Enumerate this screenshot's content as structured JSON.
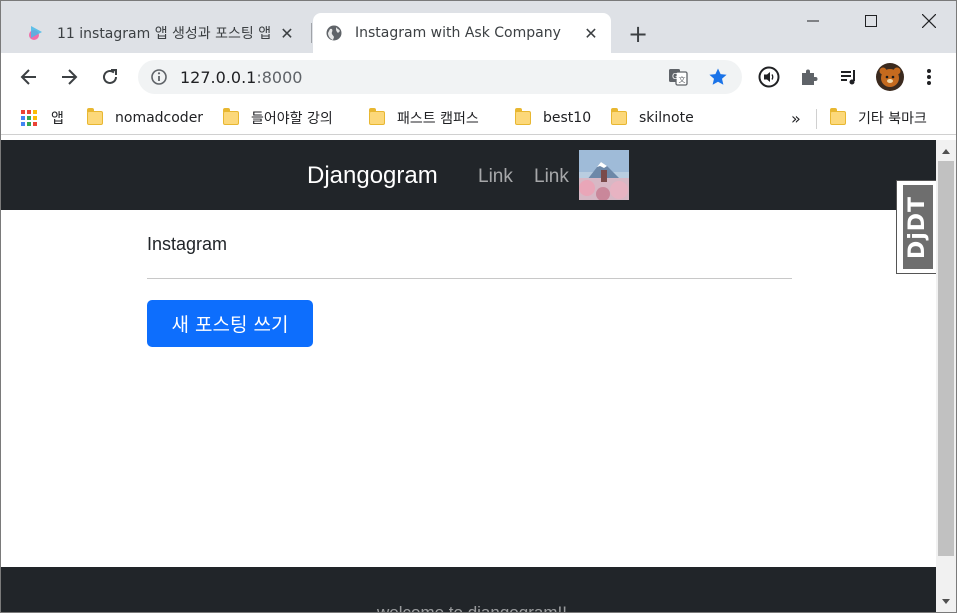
{
  "tabs": [
    {
      "title": "11 instagram 앱 생성과 포스팅 앱",
      "close": "✕"
    },
    {
      "title": "Instagram with Ask Company",
      "close": "✕"
    }
  ],
  "new_tab_label": "+",
  "toolbar": {
    "url_host": "127.0.0.1",
    "url_port": ":8000"
  },
  "bookmarks": {
    "apps": "앱",
    "items": [
      "nomadcoder",
      "들어야할 강의",
      "패스트 캠퍼스",
      "best10",
      "skilnote"
    ],
    "overflow": "»",
    "other": "기타 북마크"
  },
  "site": {
    "brand": "Djangogram",
    "links": [
      "Link",
      "Link"
    ],
    "section_title": "Instagram",
    "new_post_button": "새 포스팅 쓰기",
    "footer_text": "welcome to djangogram!!"
  },
  "djdt_label": "DjDT",
  "colors": {
    "navbar": "#212529",
    "primary": "#0d6efd",
    "star": "#1a73e8"
  }
}
